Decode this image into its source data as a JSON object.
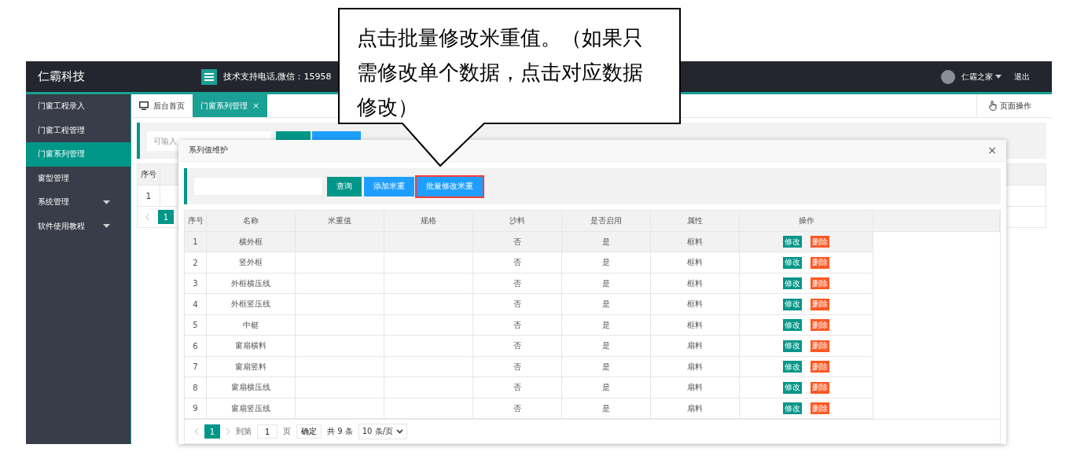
{
  "header": {
    "logo": "仁霸科技",
    "support": "技术支持电话,微信：15958",
    "user": "仁霸之家",
    "logout": "退出"
  },
  "sidebar": {
    "items": [
      {
        "label": "门窗工程录入",
        "selected": false,
        "expandable": false
      },
      {
        "label": "门窗工程管理",
        "selected": false,
        "expandable": false
      },
      {
        "label": "门窗系列管理",
        "selected": true,
        "expandable": false
      },
      {
        "label": "窗型管理",
        "selected": false,
        "expandable": false
      },
      {
        "label": "系统管理",
        "selected": false,
        "expandable": true
      },
      {
        "label": "软件使用教程",
        "selected": false,
        "expandable": true
      }
    ]
  },
  "tabs": [
    {
      "label": "后台首页",
      "selected": false,
      "kind": "home"
    },
    {
      "label": "门窗系列管理",
      "selected": true,
      "kind": "closable",
      "close_mark": "×"
    }
  ],
  "page_actions": "页面操作",
  "background": {
    "search": {
      "placeholder": "可输入"
    },
    "buttons": [
      {
        "kind": "primary"
      },
      {
        "kind": "normal"
      }
    ],
    "table": {
      "columns": [
        "序号"
      ],
      "rows": [
        "1"
      ]
    },
    "pagination": {
      "pages": [
        {
          "label": "1",
          "selected": true
        }
      ]
    }
  },
  "modal": {
    "title": "系列值维护",
    "close_mark": "×",
    "buttons": [
      {
        "label": "查询",
        "kind": "primary",
        "highlighted": false
      },
      {
        "label": "添加米重",
        "kind": "normal",
        "highlighted": false
      },
      {
        "label": "批量修改米重",
        "kind": "normal",
        "highlighted": true
      }
    ],
    "table": {
      "columns": [
        "序号",
        "名称",
        "米重值",
        "规格",
        "沙料",
        "是否启用",
        "属性",
        "操作"
      ],
      "rows": [
        {
          "index": "1",
          "name": "横外框",
          "sand": "否",
          "enabled": "是",
          "attribute": "框料",
          "actions": [
            "修改",
            "删除"
          ],
          "selected": true
        },
        {
          "index": "2",
          "name": "竖外框",
          "sand": "否",
          "enabled": "是",
          "attribute": "框料",
          "actions": [
            "修改",
            "删除"
          ],
          "selected": false
        },
        {
          "index": "3",
          "name": "外框横压线",
          "sand": "否",
          "enabled": "是",
          "attribute": "框料",
          "actions": [
            "修改",
            "删除"
          ],
          "selected": false
        },
        {
          "index": "4",
          "name": "外框竖压线",
          "sand": "否",
          "enabled": "是",
          "attribute": "框料",
          "actions": [
            "修改",
            "删除"
          ],
          "selected": false
        },
        {
          "index": "5",
          "name": "中梃",
          "sand": "否",
          "enabled": "是",
          "attribute": "框料",
          "actions": [
            "修改",
            "删除"
          ],
          "selected": false
        },
        {
          "index": "6",
          "name": "窗扇横料",
          "sand": "否",
          "enabled": "是",
          "attribute": "扇料",
          "actions": [
            "修改",
            "删除"
          ],
          "selected": false
        },
        {
          "index": "7",
          "name": "窗扇竖料",
          "sand": "否",
          "enabled": "是",
          "attribute": "扇料",
          "actions": [
            "修改",
            "删除"
          ],
          "selected": false
        },
        {
          "index": "8",
          "name": "窗扇横压线",
          "sand": "否",
          "enabled": "是",
          "attribute": "扇料",
          "actions": [
            "修改",
            "删除"
          ],
          "selected": false
        },
        {
          "index": "9",
          "name": "窗扇竖压线",
          "sand": "否",
          "enabled": "是",
          "attribute": "扇料",
          "actions": [
            "修改",
            "删除"
          ],
          "selected": false
        }
      ]
    },
    "pagination": {
      "pages": [
        {
          "label": "1",
          "selected": true
        }
      ],
      "goto_label": "到第",
      "goto_value": "1",
      "page_unit": "页",
      "confirm": "确定",
      "total": "共 9 条",
      "page_size": "10 条/页"
    }
  },
  "callout": {
    "text": "点击批量修改米重值。（如果只需修改单个数据，点击对应数据修改）"
  }
}
